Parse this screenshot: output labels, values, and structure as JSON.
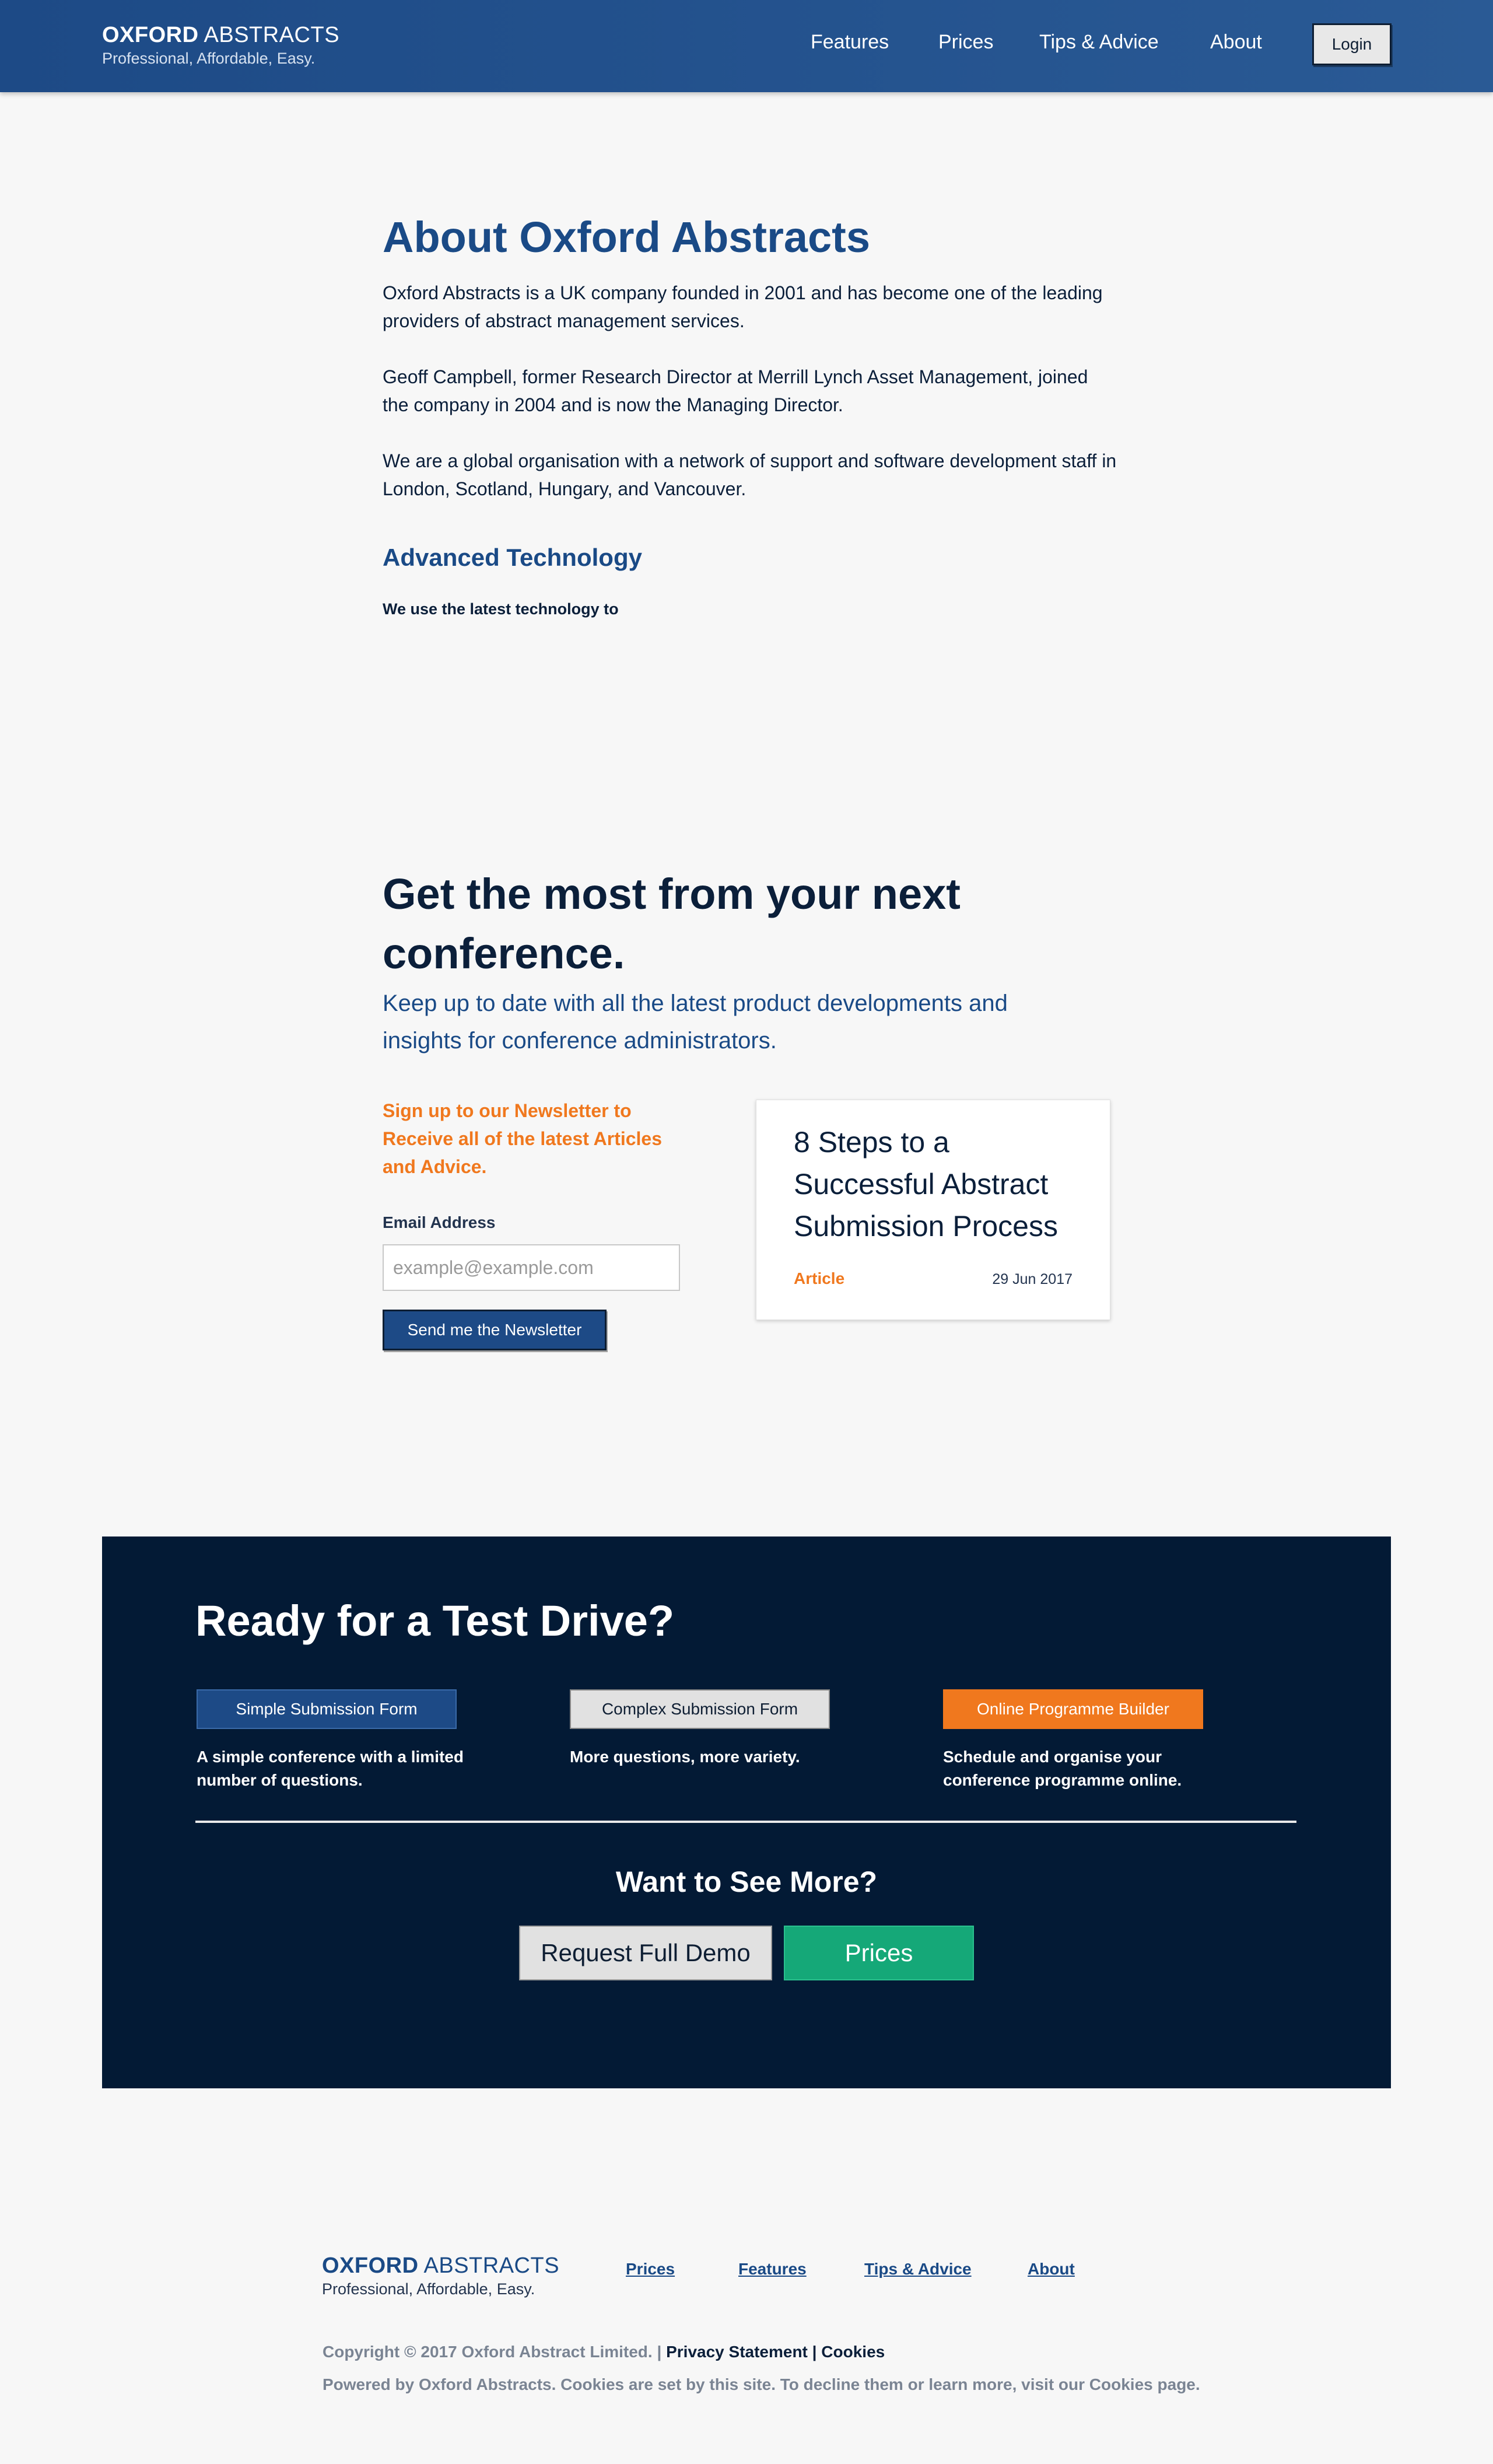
{
  "header": {
    "logo_bold": "OXFORD",
    "logo_rest": " ABSTRACTS",
    "tagline": "Professional, Affordable, Easy.",
    "nav": [
      "Features",
      "Prices",
      "Tips & Advice",
      "About"
    ],
    "login_label": "Login",
    "color": "#1d4a86"
  },
  "about": {
    "title": "About Oxford Abstracts",
    "paragraphs": [
      "Oxford Abstracts is a UK company founded in 2001 and has become one of the leading providers of abstract management services.",
      "Geoff Campbell, former Research Director at Merrill Lynch Asset Management, joined the company in 2004 and is now the Managing Director.",
      "We are a global organisation with a network of support and software development staff in London, Scotland, Hungary, and Vancouver."
    ],
    "subheading": "Advanced Technology",
    "subtext": "We use the latest technology to"
  },
  "newsletter": {
    "title": "Get the most from your next conference.",
    "subtitle": "Keep up to date with all the latest product developments and insights for conference administrators.",
    "signup_text": "Sign up to our Newsletter to Receive all of the latest Articles and Advice.",
    "email_label": "Email Address",
    "email_placeholder": "example@example.com",
    "send_label": "Send me the Newsletter",
    "accent_color": "#f0781e"
  },
  "article": {
    "title": "8 Steps to a Successful Abstract Submission Process",
    "type": "Article",
    "date": "29 Jun 2017"
  },
  "testdrive": {
    "title": "Ready for a Test Drive?",
    "options": [
      {
        "label": "Simple Submission Form",
        "desc": "A simple conference with a limited number of questions."
      },
      {
        "label": "Complex Submission Form",
        "desc": "More questions, more variety."
      },
      {
        "label": "Online Programme Builder",
        "desc": "Schedule and organise your conference programme online."
      }
    ],
    "more_title": "Want to See More?",
    "demo_label": "Request Full Demo",
    "prices_label": "Prices",
    "background": "#031a35",
    "green": "#15a878"
  },
  "footer": {
    "logo_bold": "OXFORD",
    "logo_rest": " ABSTRACTS",
    "tagline": "Professional, Affordable, Easy.",
    "links": [
      "Prices",
      "Features",
      "Tips & Advice",
      "About"
    ],
    "copyright": "Copyright © 2017 Oxford Abstract Limited. | ",
    "privacy": "Privacy Statement",
    "separator": " | ",
    "cookies": "Cookies",
    "powered": "Powered by Oxford Abstracts. Cookies are set by this site. To decline them or learn more, visit our Cookies page."
  }
}
